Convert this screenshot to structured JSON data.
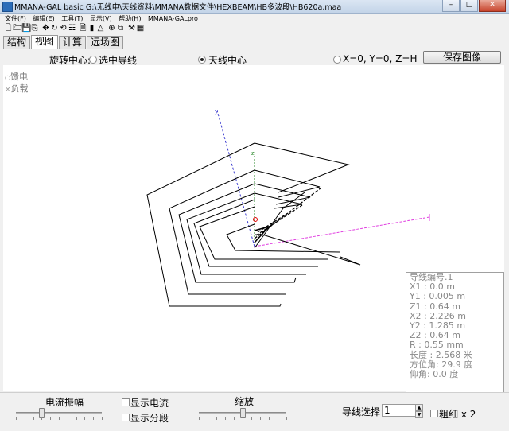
{
  "window": {
    "title": "MMANA-GAL basic G:\\无线电\\天线资料\\MMANA数据文件\\HEXBEAM\\HB多波段\\HB620a.maa",
    "minimize": "–",
    "maximize": "□",
    "close": "✕"
  },
  "menu": [
    "文件(F)",
    "编辑(E)",
    "工具(T)",
    "显示(V)",
    "帮助(H)",
    "MMANA-GALpro"
  ],
  "toolbar": [
    {
      "icon": "new-file-icon",
      "glyph": "🗋"
    },
    {
      "icon": "open-folder-icon",
      "glyph": "🗁"
    },
    {
      "icon": "save-icon",
      "glyph": "💾"
    },
    {
      "icon": "copy-icon",
      "glyph": "⎘"
    },
    {
      "icon": "move-icon",
      "glyph": "✥"
    },
    {
      "icon": "rotate-icon",
      "glyph": "↻"
    },
    {
      "icon": "reset-icon",
      "glyph": "⟲"
    },
    {
      "icon": "table-icon",
      "glyph": "☷"
    },
    {
      "icon": "document-icon",
      "glyph": "🗎"
    },
    {
      "icon": "bars-icon",
      "glyph": "▮"
    },
    {
      "icon": "triangle-icon",
      "glyph": "△"
    },
    {
      "icon": "crosshair-icon",
      "glyph": "⊕"
    },
    {
      "icon": "duplicate-icon",
      "glyph": "⧉"
    },
    {
      "icon": "tools-icon",
      "glyph": "⚒"
    },
    {
      "icon": "calculator-icon",
      "glyph": "▦"
    }
  ],
  "tabs": [
    {
      "label": "结构",
      "active": false
    },
    {
      "label": "视图",
      "active": true
    },
    {
      "label": "计算",
      "active": false
    },
    {
      "label": "远场图",
      "active": false
    }
  ],
  "view_options": {
    "rotation_label": "旋转中心:",
    "option_selected_wire": "选中导线",
    "option_antenna_center": "天线中心",
    "option_origin": "X=0, Y=0, Z=H",
    "selected": "antenna_center",
    "save_image": "保存图像"
  },
  "legend": {
    "feed": "馈电",
    "load": "负载",
    "feed_marker": "○",
    "load_marker": "×"
  },
  "axes": {
    "z_label": "z",
    "y_label": "y",
    "x_label": "x"
  },
  "wire_info": [
    "导线编号.1",
    "X1  : 0.0 m",
    "Y1  : 0.005 m",
    "Z1  : 0.64 m",
    "X2  : 2.226 m",
    "Y2  : 1.285 m",
    "Z2  : 0.64 m",
    "R   : 0.55 mm",
    "长度 : 2.568 米",
    "方位角: 29.9 度",
    "仰角: 0.0 度"
  ],
  "bottom": {
    "current_amp": "电流振幅",
    "show_current": "显示电流",
    "show_segments": "显示分段",
    "zoom": "缩放",
    "wire_select": "导线选择",
    "wire_select_value": "1",
    "bold_x2": "粗细 x 2",
    "current_amp_slider": 0.3,
    "zoom_slider": 0.5
  },
  "colors": {
    "z_axis": "#2e8b2e",
    "y_axis": "#3a3ad0",
    "x_axis": "#e040e0",
    "feed": "#e00000",
    "wire": "#000000"
  }
}
